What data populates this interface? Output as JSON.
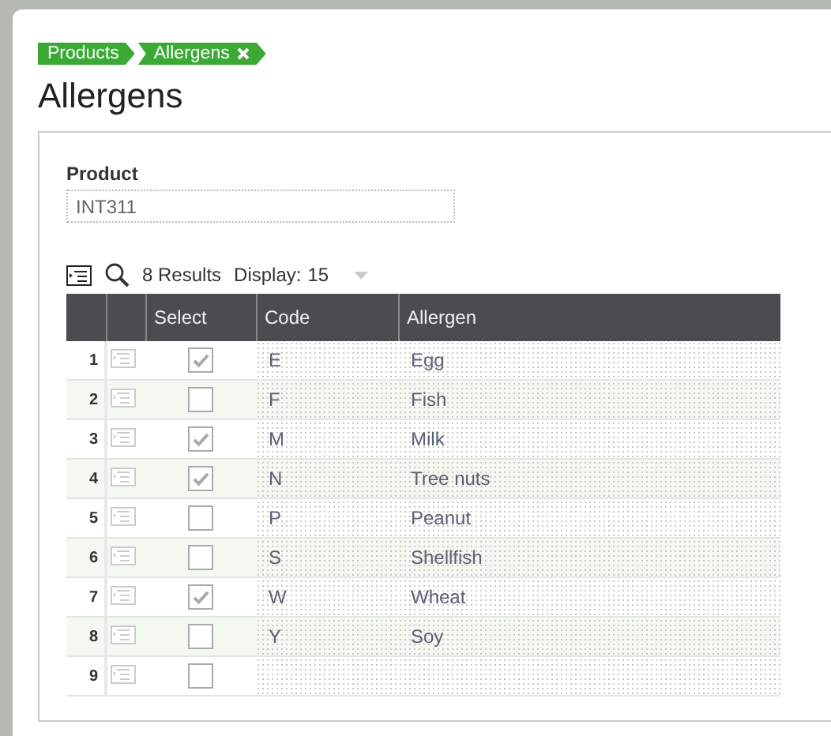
{
  "breadcrumbs": [
    {
      "label": "Products",
      "closable": false
    },
    {
      "label": "Allergens",
      "closable": true
    }
  ],
  "title": "Allergens",
  "product": {
    "label": "Product",
    "value": "INT311"
  },
  "toolbar": {
    "results": "8 Results",
    "display_label": "Display:",
    "display_value": "15"
  },
  "table": {
    "columns": [
      "Select",
      "Code",
      "Allergen"
    ],
    "rows": [
      {
        "number": "1",
        "checked": true,
        "code": "E",
        "allergen": "Egg"
      },
      {
        "number": "2",
        "checked": false,
        "code": "F",
        "allergen": "Fish"
      },
      {
        "number": "3",
        "checked": true,
        "code": "M",
        "allergen": "Milk"
      },
      {
        "number": "4",
        "checked": true,
        "code": "N",
        "allergen": "Tree nuts"
      },
      {
        "number": "5",
        "checked": false,
        "code": "P",
        "allergen": "Peanut"
      },
      {
        "number": "6",
        "checked": false,
        "code": "S",
        "allergen": "Shellfish"
      },
      {
        "number": "7",
        "checked": true,
        "code": "W",
        "allergen": "Wheat"
      },
      {
        "number": "8",
        "checked": false,
        "code": "Y",
        "allergen": "Soy"
      },
      {
        "number": "9",
        "checked": false,
        "code": "",
        "allergen": ""
      }
    ]
  }
}
